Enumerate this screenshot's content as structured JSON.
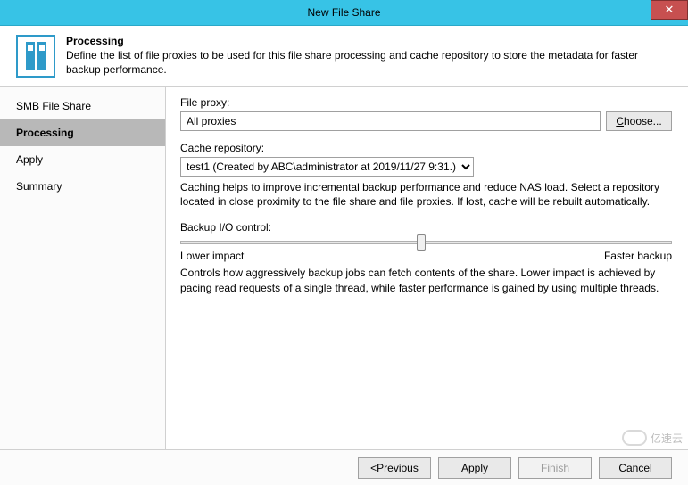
{
  "window": {
    "title": "New File Share",
    "close_glyph": "✕"
  },
  "header": {
    "title": "Processing",
    "desc": "Define the list of file proxies to be used for this file share processing and cache repository to store the metadata for faster backup performance."
  },
  "sidebar": {
    "items": [
      {
        "label": "SMB File Share",
        "active": false
      },
      {
        "label": "Processing",
        "active": true
      },
      {
        "label": "Apply",
        "active": false
      },
      {
        "label": "Summary",
        "active": false
      }
    ]
  },
  "content": {
    "file_proxy_label": "File proxy:",
    "file_proxy_value": "All proxies",
    "choose_label_prefix": "C",
    "choose_label_rest": "hoose...",
    "cache_label": "Cache repository:",
    "cache_value": "test1 (Created by ABC\\administrator at 2019/11/27 9:31.)",
    "cache_help": "Caching helps to improve incremental backup performance and reduce NAS load. Select a repository located in close proximity to the file share and file proxies. If lost, cache will be rebuilt automatically.",
    "io_label": "Backup I/O control:",
    "io_low": "Lower impact",
    "io_high": "Faster backup",
    "io_help": "Controls how aggressively backup jobs can fetch contents of the share. Lower impact is achieved by pacing read requests of a single thread, while faster performance is gained by using multiple threads."
  },
  "footer": {
    "previous_prefix": "< ",
    "previous_accesskey": "P",
    "previous_rest": "revious",
    "apply_label": "Apply",
    "finish_accesskey": "F",
    "finish_rest": "inish",
    "cancel_label": "Cancel"
  },
  "watermark": {
    "text": "亿速云"
  }
}
